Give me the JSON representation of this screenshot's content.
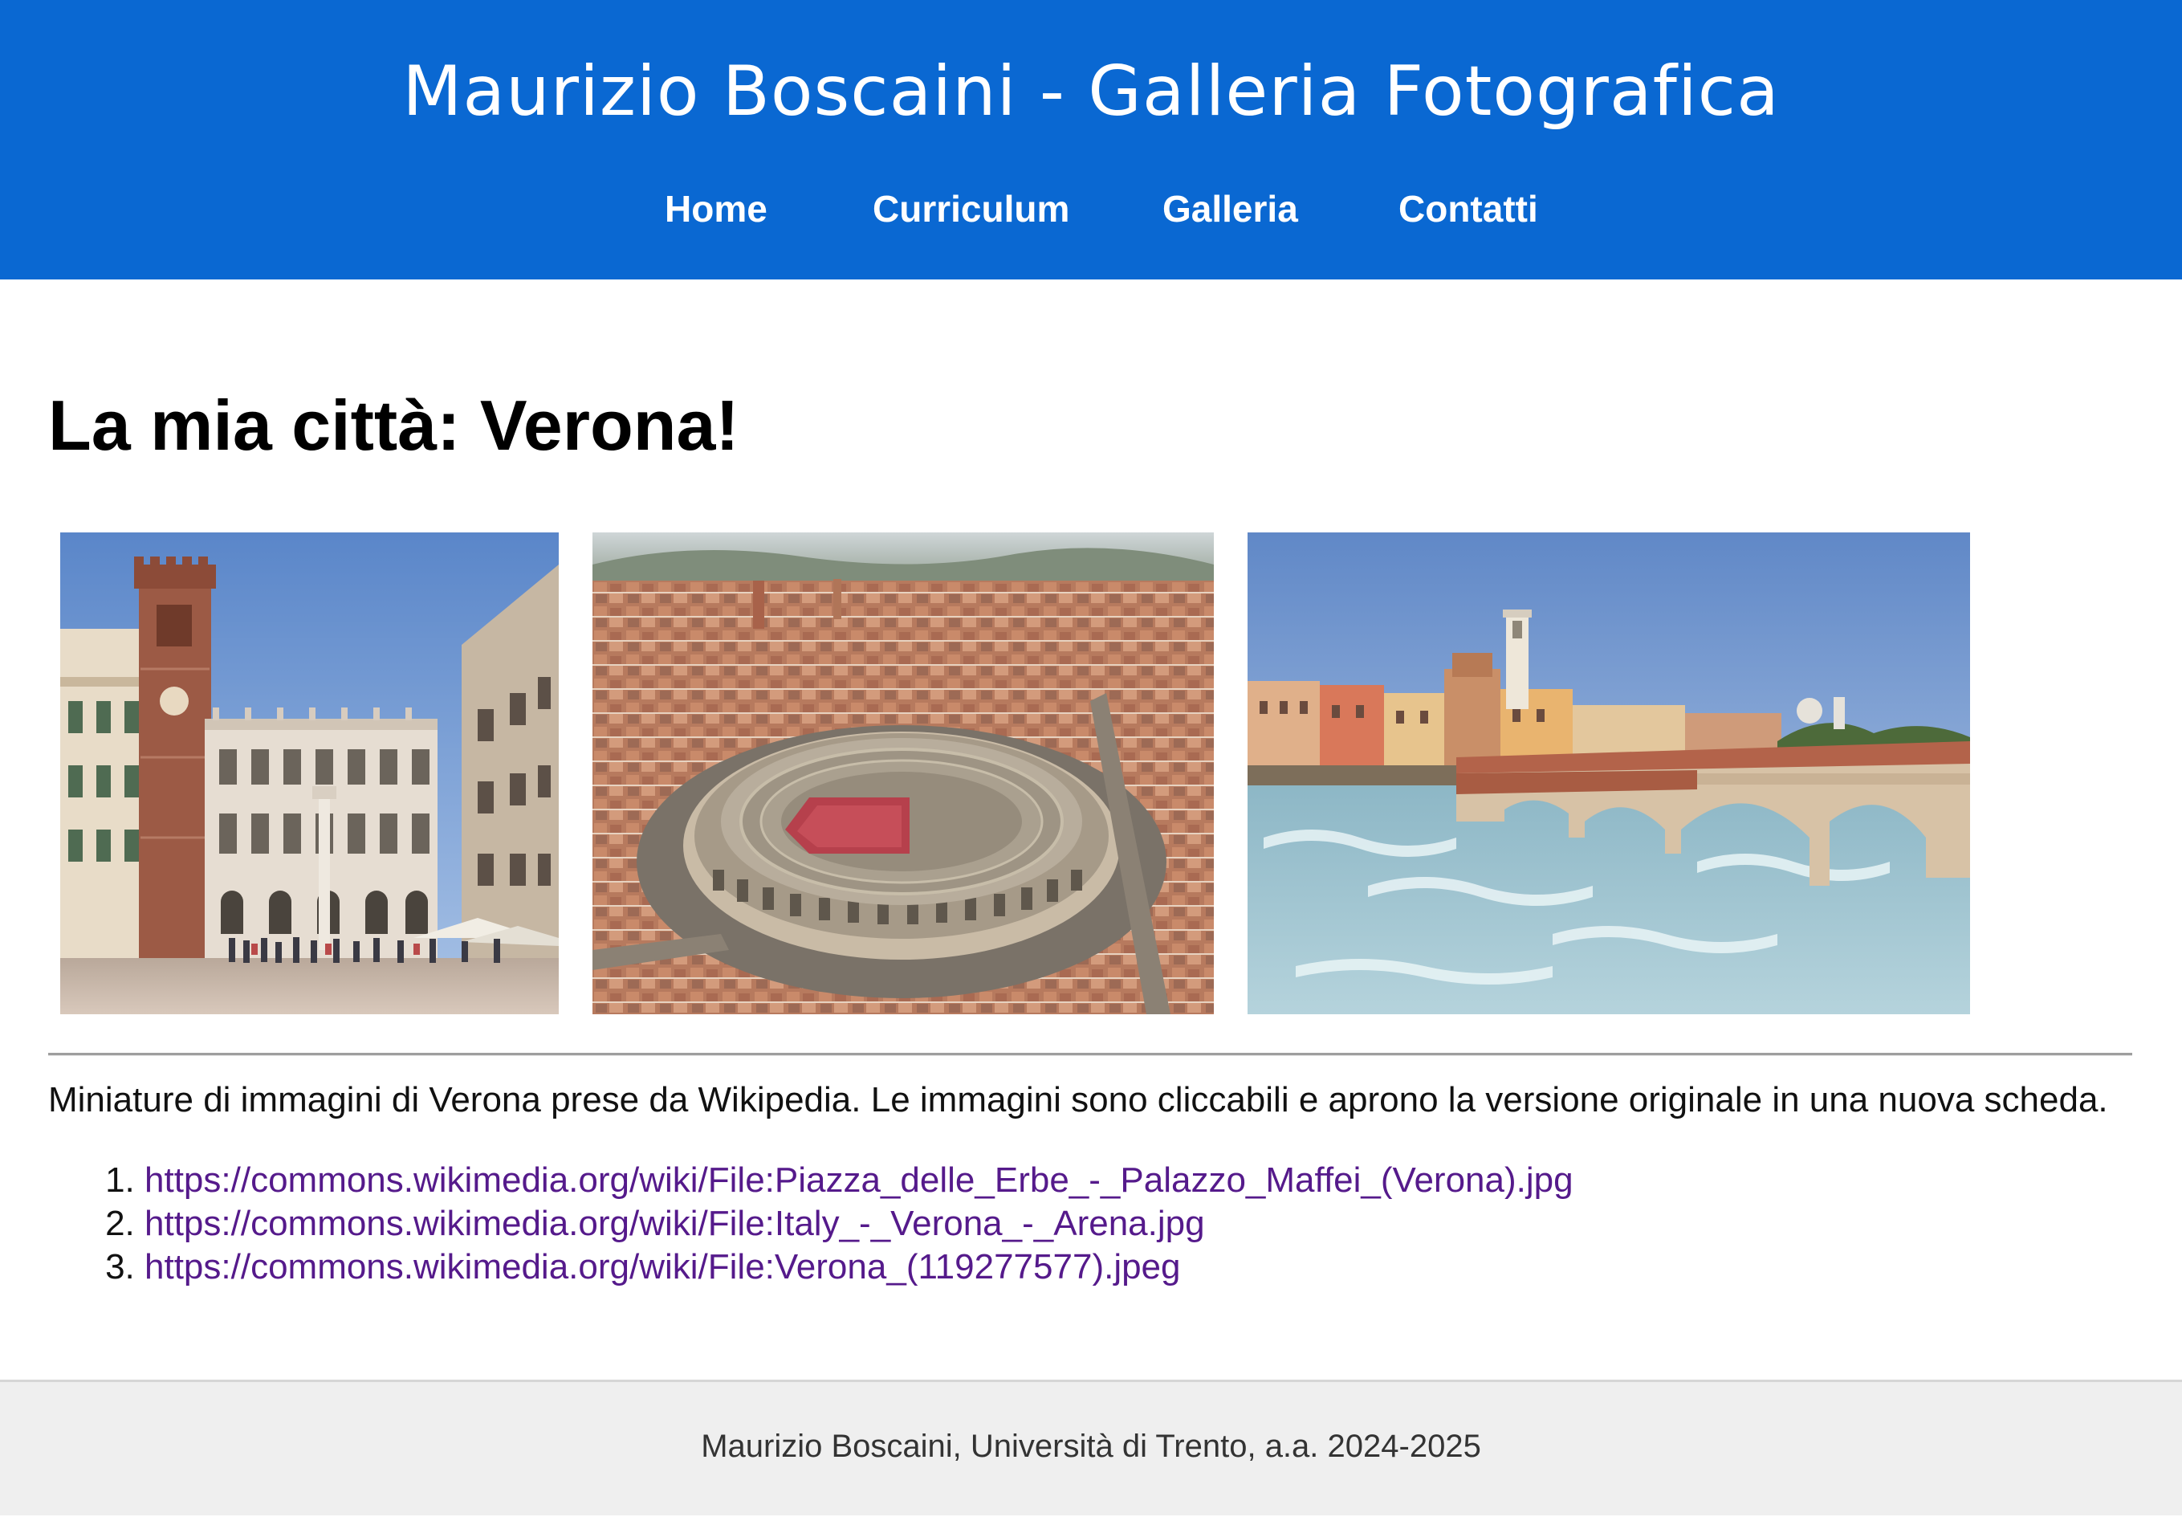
{
  "header": {
    "title": "Maurizio Boscaini - Galleria Fotografica",
    "background_color": "#0a68d2",
    "nav": [
      {
        "label": "Home"
      },
      {
        "label": "Curriculum"
      },
      {
        "label": "Galleria"
      },
      {
        "label": "Contatti"
      }
    ]
  },
  "main": {
    "heading": "La mia città: Verona!",
    "thumbnails": [
      {
        "subject": "Piazza delle Erbe - Palazzo Maffei"
      },
      {
        "subject": "Arena di Verona (aerial)"
      },
      {
        "subject": "Ponte Pietra sull'Adige"
      }
    ],
    "caption": "Miniature di immagini di Verona prese da Wikipedia. Le immagini sono cliccabili e aprono la versione originale in una nuova scheda.",
    "sources": [
      "https://commons.wikimedia.org/wiki/File:Piazza_delle_Erbe_-_Palazzo_Maffei_(Verona).jpg",
      "https://commons.wikimedia.org/wiki/File:Italy_-_Verona_-_Arena.jpg",
      "https://commons.wikimedia.org/wiki/File:Verona_(119277577).jpeg"
    ],
    "link_color": "#551a8b"
  },
  "footer": {
    "text": "Maurizio Boscaini, Università di Trento, a.a. 2024-2025"
  }
}
